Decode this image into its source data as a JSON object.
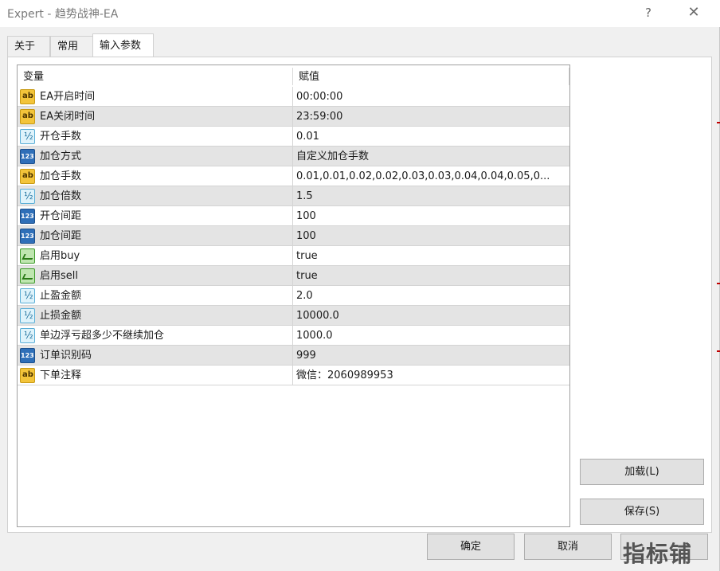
{
  "window": {
    "title": "Expert - 趋势战神-EA",
    "help_glyph": "?",
    "close_glyph": "✕"
  },
  "tabs": [
    {
      "label": "关于"
    },
    {
      "label": "常用"
    },
    {
      "label": "输入参数"
    }
  ],
  "grid": {
    "col_variable": "变量",
    "col_value": "赋值",
    "rows": [
      {
        "icon": "string-icon",
        "name": "EA开启时间",
        "value": "00:00:00"
      },
      {
        "icon": "string-icon",
        "name": "EA关闭时间",
        "value": "23:59:00"
      },
      {
        "icon": "double-icon",
        "name": "开仓手数",
        "value": "0.01"
      },
      {
        "icon": "enum-int-icon",
        "name": "加仓方式",
        "value": "自定义加仓手数"
      },
      {
        "icon": "string-icon",
        "name": "加仓手数",
        "value": "0.01,0.01,0.02,0.02,0.03,0.03,0.04,0.04,0.05,0..."
      },
      {
        "icon": "double-icon",
        "name": "加仓倍数",
        "value": "1.5"
      },
      {
        "icon": "enum-int-icon",
        "name": "开仓间距",
        "value": "100"
      },
      {
        "icon": "enum-int-icon",
        "name": "加仓间距",
        "value": "100"
      },
      {
        "icon": "bool-icon",
        "name": "启用buy",
        "value": "true"
      },
      {
        "icon": "bool-icon",
        "name": "启用sell",
        "value": "true"
      },
      {
        "icon": "double-icon",
        "name": "止盈金额",
        "value": "2.0"
      },
      {
        "icon": "double-icon",
        "name": "止损金额",
        "value": "10000.0"
      },
      {
        "icon": "double-icon",
        "name": "单边浮亏超多少不继续加仓",
        "value": "1000.0"
      },
      {
        "icon": "enum-int-icon",
        "name": "订单识别码",
        "value": "999"
      },
      {
        "icon": "string-icon",
        "name": "下单注释",
        "value": "微信：2060989953"
      }
    ]
  },
  "buttons": {
    "load": "加载(L)",
    "save": "保存(S)",
    "ok": "确定",
    "cancel": "取消",
    "reset": ""
  },
  "watermark": "指标铺",
  "colors": {
    "row_alt": "#e4e4e4",
    "string_icon": "#f3c43a",
    "double_icon": "#dff3fb",
    "int_icon": "#2f6fb8",
    "bool_icon": "#bfe6b0"
  }
}
